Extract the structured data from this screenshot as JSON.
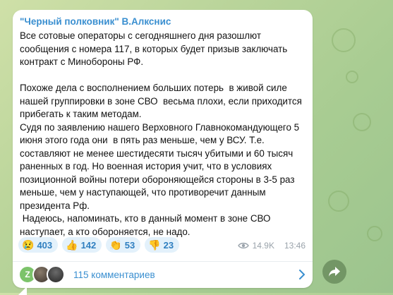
{
  "post": {
    "channel_name": "\"Черный полковник\" В.Алкснис",
    "text": "Все сотовые операторы с сегодняшнего дня разошлют\nсообщения с номера 117, в которых будет призыв заключать\nконтракт с Минобороны РФ.\n\nПохоже дела с восполнением больших потерь  в живой силе\nнашей группировки в зоне СВО  весьма плохи, если приходится\nприбегать к таким методам.\nСудя по заявлению нашего Верховного Главнокомандующего 5\nиюня этого года они  в пять раз меньше, чем у ВСУ. Т.е.\nсоставляют не менее шестидесяти тысяч убитыми и 60 тысяч\nраненных в год. Но военная история учит, что в условиях\nпозиционной войны потери обороняющейся стороны в 3-5 раз\nменьше, чем у наступающей, что противоречит данным\nпрезидента Рф.\n Надеюсь, напоминать, кто в данный момент в зоне СВО\nнаступает, а кто обороняется, не надо.",
    "reactions": [
      {
        "emoji": "😢",
        "icon": "crying-face-icon",
        "count": "403"
      },
      {
        "emoji": "👍",
        "icon": "thumbs-up-icon",
        "count": "142"
      },
      {
        "emoji": "👏",
        "icon": "clapping-hands-icon",
        "count": "53"
      },
      {
        "emoji": "👎",
        "icon": "thumbs-down-icon",
        "count": "23"
      }
    ],
    "views": "14.9K",
    "time": "13:46",
    "comments": {
      "avatar_letter": "Z",
      "label": "115 комментариев"
    }
  },
  "colors": {
    "accent": "#3a8fd0",
    "reaction_bg": "#e3f1fb",
    "bubble": "#ffffff"
  }
}
